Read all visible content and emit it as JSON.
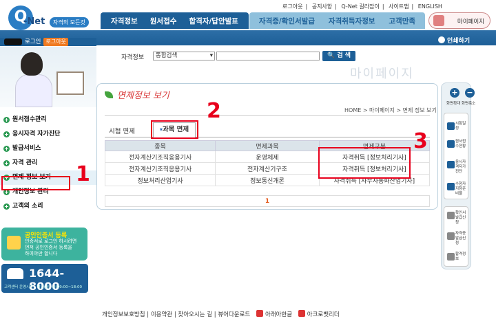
{
  "logo": {
    "q": "Q",
    "net": "-Net",
    "tagline": "자격의 모든것"
  },
  "topbar": [
    "로그아웃",
    "|",
    "공지사항",
    "|",
    "Q-Net 길라잡이",
    "|",
    "사이트맵",
    "|",
    "ENGLISH"
  ],
  "mainnav": [
    "자격정보",
    "원서접수",
    "합격자/답안발표"
  ],
  "subnav": [
    "자격증/확인서발급",
    "자격취득자정보",
    "고객만족"
  ],
  "mypage_button": "마이페이지",
  "login": {
    "label": "로그인",
    "logout": "로그아웃"
  },
  "print_label": "인쇄하기",
  "search": {
    "label": "자격정보",
    "select": "통합검색",
    "button": "검 색"
  },
  "mypage_watermark": "마이페이지",
  "leftmenu": [
    {
      "label": "원서접수관리",
      "active": false
    },
    {
      "label": "응시자격 자가진단",
      "active": false
    },
    {
      "label": "발급서비스",
      "active": false
    },
    {
      "label": "자격 관리",
      "active": false
    },
    {
      "label": "면제 정보 보기",
      "active": true
    },
    {
      "label": "개인정보 관리",
      "active": false
    },
    {
      "label": "고객의 소리",
      "active": false
    }
  ],
  "cert": {
    "title": "공인인증서 등록",
    "desc1": "인증서로 로그인 하시려면",
    "desc2": "먼저 공인인증서 등록을",
    "desc3": "하여야만 합니다"
  },
  "phone": {
    "number": "1644-8000",
    "hours": "고객센터 운영시간 : 평일(월~금)09:00~18:00"
  },
  "page_title": "면제정보 보기",
  "breadcrumb": "HOME > 마이페이지 > 면제 정보 보기",
  "tabs": {
    "tab1": "시험 면제",
    "tab2": "과목 면제",
    "tab2_marker": "▾"
  },
  "table": {
    "headers": [
      "종목",
      "면제과목",
      "면제구분"
    ],
    "rows": [
      [
        "전자계산기조직응용기사",
        "운영체제",
        "자격취득 [정보처리기사]"
      ],
      [
        "전자계산기조직응용기사",
        "전자계산기구조",
        "자격취득 [정보처리기사]"
      ],
      [
        "정보처리산업기사",
        "정보통신개론",
        "자격취득 [사무자동화산업기사]"
      ]
    ]
  },
  "pager": "1",
  "annotations": [
    "1",
    "2",
    "3"
  ],
  "right_quick": {
    "zoom_in": "화면확대",
    "zoom_out": "화면축소",
    "items": [
      "시험일정",
      "원서접수현황",
      "응시자격자가진단",
      "수험자지참준비물"
    ],
    "items2": [
      "확인서발급신청",
      "자격증발급신청",
      "합격정보"
    ]
  },
  "footer": {
    "privacy": "개인정보보호방침",
    "terms": "이용약관",
    "directions": "찾아오시는 길",
    "viewer": "뷰어다운로드",
    "hangul": "아래아한글",
    "acrobat": "아크로뱃리더"
  },
  "colors": {
    "navy": "#1d5f97",
    "green": "#2e9b55",
    "annotation_red": "#e8001c",
    "teal": "#3db39e"
  }
}
